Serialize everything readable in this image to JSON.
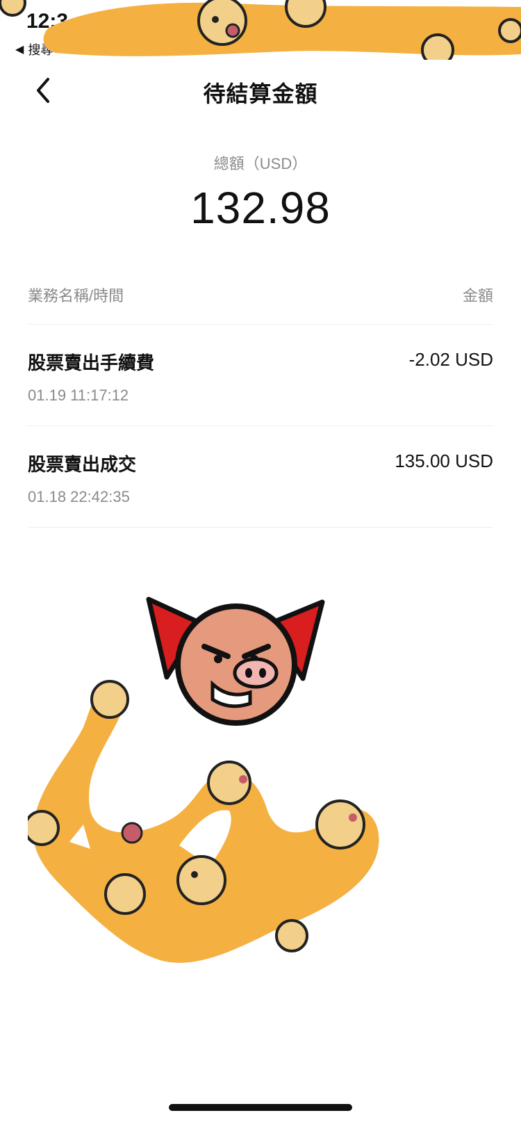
{
  "status_bar": {
    "time": "12:3",
    "back_app": "搜尋"
  },
  "nav": {
    "title": "待結算金額"
  },
  "summary": {
    "label": "總額（USD）",
    "value": "132.98"
  },
  "list": {
    "header_left": "業務名稱/時間",
    "header_right": "金額",
    "rows": [
      {
        "name": "股票賣出手續費",
        "time": "01.19 11:17:12",
        "amount": "-2.02 USD"
      },
      {
        "name": "股票賣出成交",
        "time": "01.18 22:42:35",
        "amount": "135.00 USD"
      }
    ]
  },
  "icons": {
    "back": "chevron-left-icon",
    "pig": "angry-pig-sticker",
    "dog": "shiba-sticker-scribble"
  },
  "colors": {
    "scribble": "#F5B042",
    "pig_ear": "#D81E1E",
    "pig_face": "#E59A7E",
    "text_primary": "#111111",
    "text_secondary": "#8A8A8A",
    "divider": "#EEEEEE"
  }
}
